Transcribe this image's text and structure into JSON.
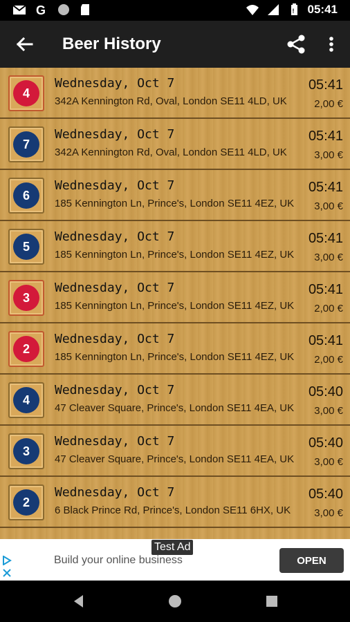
{
  "status_bar": {
    "time": "05:41",
    "left_icons": [
      "gmail-icon",
      "google-icon",
      "circle-icon",
      "sd-card-icon"
    ],
    "right_icons": [
      "wifi-icon",
      "signal-icon",
      "battery-icon"
    ]
  },
  "app_bar": {
    "title": "Beer History"
  },
  "entries": [
    {
      "count": "4",
      "color": "red",
      "date": "Wednesday, Oct 7",
      "address": "342A Kennington Rd, Oval, London SE11 4LD, UK",
      "time": "05:41",
      "price": "2,00 €"
    },
    {
      "count": "7",
      "color": "blue",
      "date": "Wednesday, Oct 7",
      "address": "342A Kennington Rd, Oval, London SE11 4LD, UK",
      "time": "05:41",
      "price": "3,00 €"
    },
    {
      "count": "6",
      "color": "blue",
      "date": "Wednesday, Oct 7",
      "address": "185 Kennington Ln, Prince's, London SE11 4EZ, UK",
      "time": "05:41",
      "price": "3,00 €"
    },
    {
      "count": "5",
      "color": "blue",
      "date": "Wednesday, Oct 7",
      "address": "185 Kennington Ln, Prince's, London SE11 4EZ, UK",
      "time": "05:41",
      "price": "3,00 €"
    },
    {
      "count": "3",
      "color": "red",
      "date": "Wednesday, Oct 7",
      "address": "185 Kennington Ln, Prince's, London SE11 4EZ, UK",
      "time": "05:41",
      "price": "2,00 €"
    },
    {
      "count": "2",
      "color": "red",
      "date": "Wednesday, Oct 7",
      "address": "185 Kennington Ln, Prince's, London SE11 4EZ, UK",
      "time": "05:41",
      "price": "2,00 €"
    },
    {
      "count": "4",
      "color": "blue",
      "date": "Wednesday, Oct 7",
      "address": "47 Cleaver Square, Prince's, London SE11 4EA, UK",
      "time": "05:40",
      "price": "3,00 €"
    },
    {
      "count": "3",
      "color": "blue",
      "date": "Wednesday, Oct 7",
      "address": "47 Cleaver Square, Prince's, London SE11 4EA, UK",
      "time": "05:40",
      "price": "3,00 €"
    },
    {
      "count": "2",
      "color": "blue",
      "date": "Wednesday, Oct 7",
      "address": "6 Black Prince Rd, Prince's, London SE11 6HX, UK",
      "time": "05:40",
      "price": "3,00 €"
    }
  ],
  "ad": {
    "label": "Test Ad",
    "text": "Build your online business",
    "button": "OPEN"
  },
  "colors": {
    "red": "#d3193a",
    "blue": "#163a74",
    "app_bar": "#1f1f1f",
    "wood": "#cc9f54"
  }
}
